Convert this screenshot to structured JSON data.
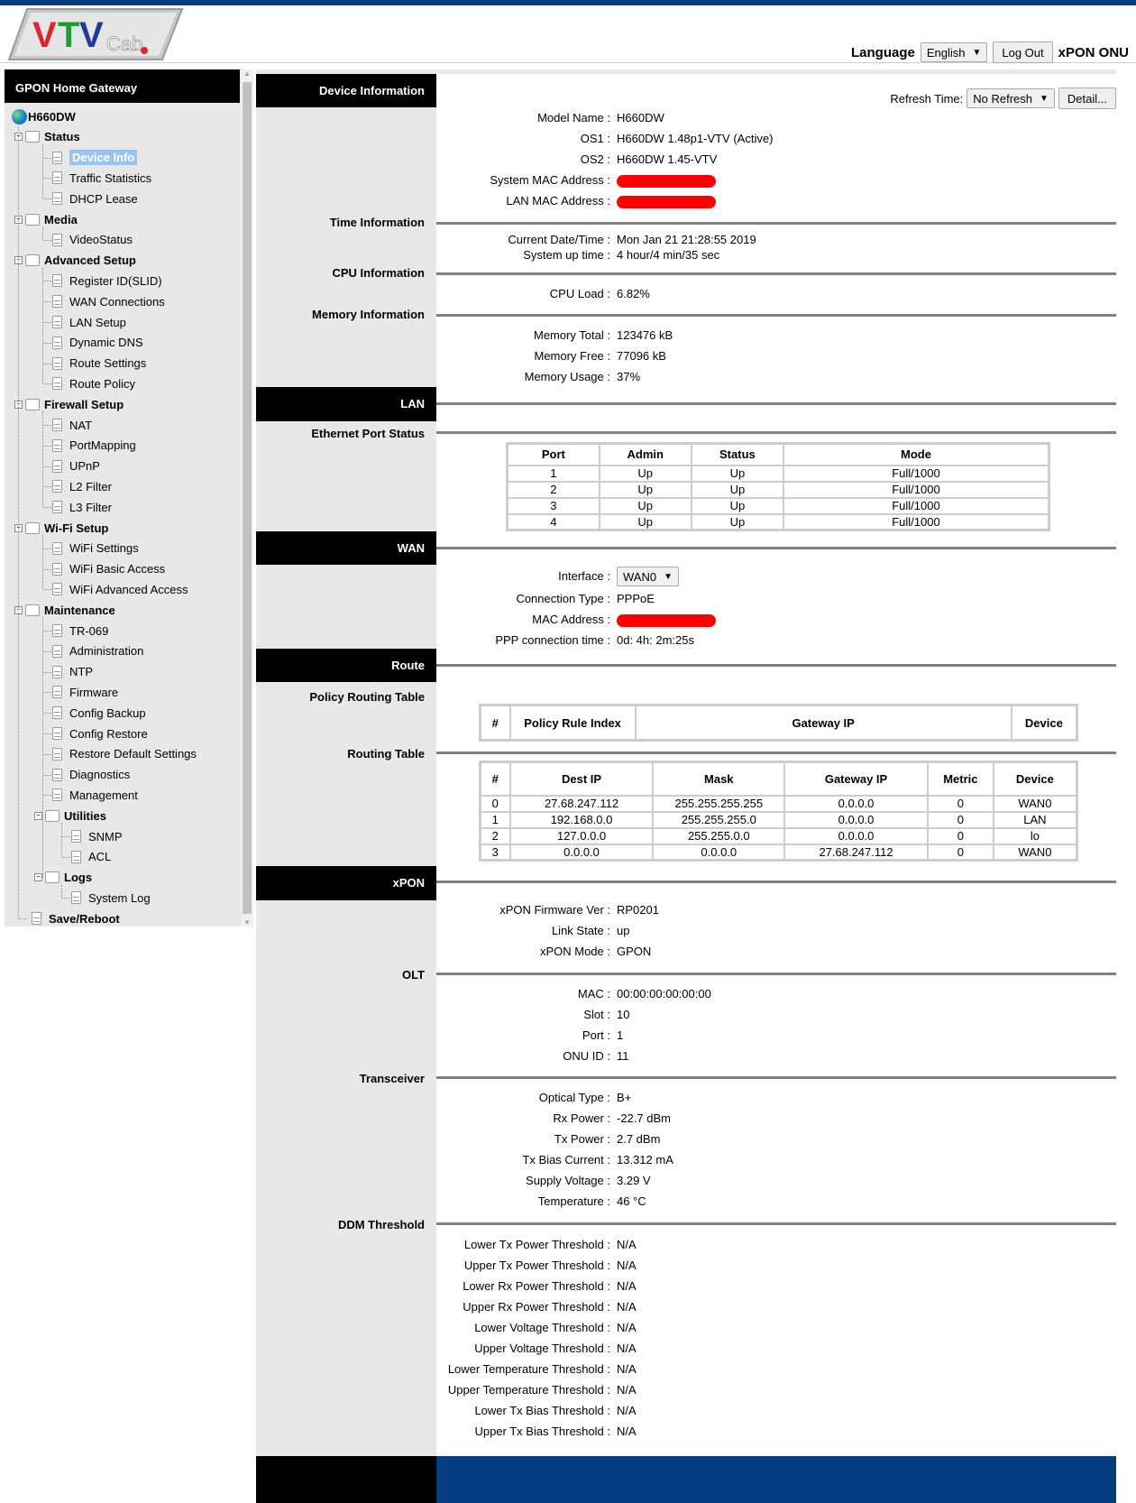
{
  "header": {
    "logo_text": "VTVCab",
    "language_label": "Language",
    "language_value": "English",
    "logout_label": "Log Out",
    "product": "xPON ONU",
    "brand_color": "#043e80"
  },
  "sidebar": {
    "title": "GPON Home Gateway",
    "root": "H660DW",
    "groups": [
      {
        "label": "Status",
        "items": [
          "Device Info",
          "Traffic Statistics",
          "DHCP Lease"
        ]
      },
      {
        "label": "Media",
        "items": [
          "VideoStatus"
        ]
      },
      {
        "label": "Advanced Setup",
        "items": [
          "Register ID(SLID)",
          "WAN Connections",
          "LAN Setup",
          "Dynamic DNS",
          "Route Settings",
          "Route Policy"
        ]
      },
      {
        "label": "Firewall Setup",
        "items": [
          "NAT",
          "PortMapping",
          "UPnP",
          "L2 Filter",
          "L3 Filter"
        ]
      },
      {
        "label": "Wi-Fi Setup",
        "items": [
          "WiFi Settings",
          "WiFi Basic Access",
          "WiFi Advanced Access"
        ]
      },
      {
        "label": "Maintenance",
        "items": [
          "TR-069",
          "Administration",
          "NTP",
          "Firmware",
          "Config Backup",
          "Config Restore",
          "Restore Default Settings",
          "Diagnostics",
          "Management"
        ]
      },
      {
        "label": "Utilities",
        "items": [
          "SNMP",
          "ACL"
        ]
      },
      {
        "label": "Logs",
        "items": [
          "System Log"
        ]
      }
    ],
    "save_reboot": "Save/Reboot",
    "selected": "Device Info"
  },
  "toolbar": {
    "refresh_label": "Refresh Time:",
    "refresh_value": "No Refresh",
    "detail_label": "Detail..."
  },
  "sections": {
    "device_info": {
      "title": "Device Information",
      "rows": [
        {
          "k": "Model Name",
          "v": "H660DW"
        },
        {
          "k": "OS1",
          "v": "H660DW 1.48p1-VTV  (Active)"
        },
        {
          "k": "OS2",
          "v": "H660DW 1.45-VTV"
        },
        {
          "k": "System MAC Address",
          "v": "[redacted]"
        },
        {
          "k": "LAN MAC Address",
          "v": "[redacted]"
        }
      ]
    },
    "time_info": {
      "title": "Time Information",
      "rows": [
        {
          "k": "Current Date/Time",
          "v": "Mon Jan 21 21:28:55 2019"
        },
        {
          "k": "System up time",
          "v": "4 hour/4 min/35 sec"
        }
      ]
    },
    "cpu_info": {
      "title": "CPU Information",
      "rows": [
        {
          "k": "CPU Load",
          "v": "6.82%"
        }
      ]
    },
    "memory_info": {
      "title": "Memory Information",
      "rows": [
        {
          "k": "Memory Total",
          "v": "123476 kB"
        },
        {
          "k": "Memory Free",
          "v": "77096 kB"
        },
        {
          "k": "Memory Usage",
          "v": "37%"
        }
      ]
    },
    "lan": {
      "title": "LAN",
      "sub": "Ethernet Port Status",
      "columns": [
        "Port",
        "Admin",
        "Status",
        "Mode"
      ],
      "rows": [
        [
          "1",
          "Up",
          "Up",
          "Full/1000"
        ],
        [
          "2",
          "Up",
          "Up",
          "Full/1000"
        ],
        [
          "3",
          "Up",
          "Up",
          "Full/1000"
        ],
        [
          "4",
          "Up",
          "Up",
          "Full/1000"
        ]
      ]
    },
    "wan": {
      "title": "WAN",
      "interface_label": "Interface",
      "interface_value": "WAN0",
      "rows": [
        {
          "k": "Connection Type",
          "v": "PPPoE"
        },
        {
          "k": "MAC Address",
          "v": "[redacted]"
        },
        {
          "k": "PPP connection time",
          "v": "0d: 4h: 2m:25s"
        }
      ]
    },
    "route": {
      "title": "Route",
      "policy_title": "Policy Routing Table",
      "policy_columns": [
        "#",
        "Policy Rule Index",
        "Gateway IP",
        "Device"
      ],
      "routing_title": "Routing Table",
      "routing_columns": [
        "#",
        "Dest IP",
        "Mask",
        "Gateway IP",
        "Metric",
        "Device"
      ],
      "routing_rows": [
        [
          "0",
          "27.68.247.112",
          "255.255.255.255",
          "0.0.0.0",
          "0",
          "WAN0"
        ],
        [
          "1",
          "192.168.0.0",
          "255.255.255.0",
          "0.0.0.0",
          "0",
          "LAN"
        ],
        [
          "2",
          "127.0.0.0",
          "255.255.0.0",
          "0.0.0.0",
          "0",
          "lo"
        ],
        [
          "3",
          "0.0.0.0",
          "0.0.0.0",
          "27.68.247.112",
          "0",
          "WAN0"
        ]
      ]
    },
    "xpon": {
      "title": "xPON",
      "rows": [
        {
          "k": "xPON Firmware Ver",
          "v": "RP0201"
        },
        {
          "k": "Link State",
          "v": "up"
        },
        {
          "k": "xPON Mode",
          "v": "GPON"
        }
      ]
    },
    "olt": {
      "title": "OLT",
      "rows": [
        {
          "k": "MAC",
          "v": "00:00:00:00:00:00"
        },
        {
          "k": "Slot",
          "v": "10"
        },
        {
          "k": "Port",
          "v": "1"
        },
        {
          "k": "ONU ID",
          "v": "11"
        }
      ]
    },
    "transceiver": {
      "title": "Transceiver",
      "rows": [
        {
          "k": "Optical Type",
          "v": "B+"
        },
        {
          "k": "Rx Power",
          "v": "-22.7 dBm"
        },
        {
          "k": "Tx Power",
          "v": "2.7 dBm"
        },
        {
          "k": "Tx Bias Current",
          "v": "13.312 mA"
        },
        {
          "k": "Supply Voltage",
          "v": "3.29 V"
        },
        {
          "k": "Temperature",
          "v": "46 °C"
        }
      ]
    },
    "ddm": {
      "title": "DDM Threshold",
      "rows": [
        {
          "k": "Lower Tx Power Threshold",
          "v": "N/A"
        },
        {
          "k": "Upper Tx Power Threshold",
          "v": "N/A"
        },
        {
          "k": "Lower Rx Power Threshold",
          "v": "N/A"
        },
        {
          "k": "Upper Rx Power Threshold",
          "v": "N/A"
        },
        {
          "k": "Lower Voltage Threshold",
          "v": "N/A"
        },
        {
          "k": "Upper Voltage Threshold",
          "v": "N/A"
        },
        {
          "k": "Lower Temperature Threshold",
          "v": "N/A"
        },
        {
          "k": "Upper Temperature Threshold",
          "v": "N/A"
        },
        {
          "k": "Lower Tx Bias Threshold",
          "v": "N/A"
        },
        {
          "k": "Upper Tx Bias Threshold",
          "v": "N/A"
        }
      ]
    }
  }
}
